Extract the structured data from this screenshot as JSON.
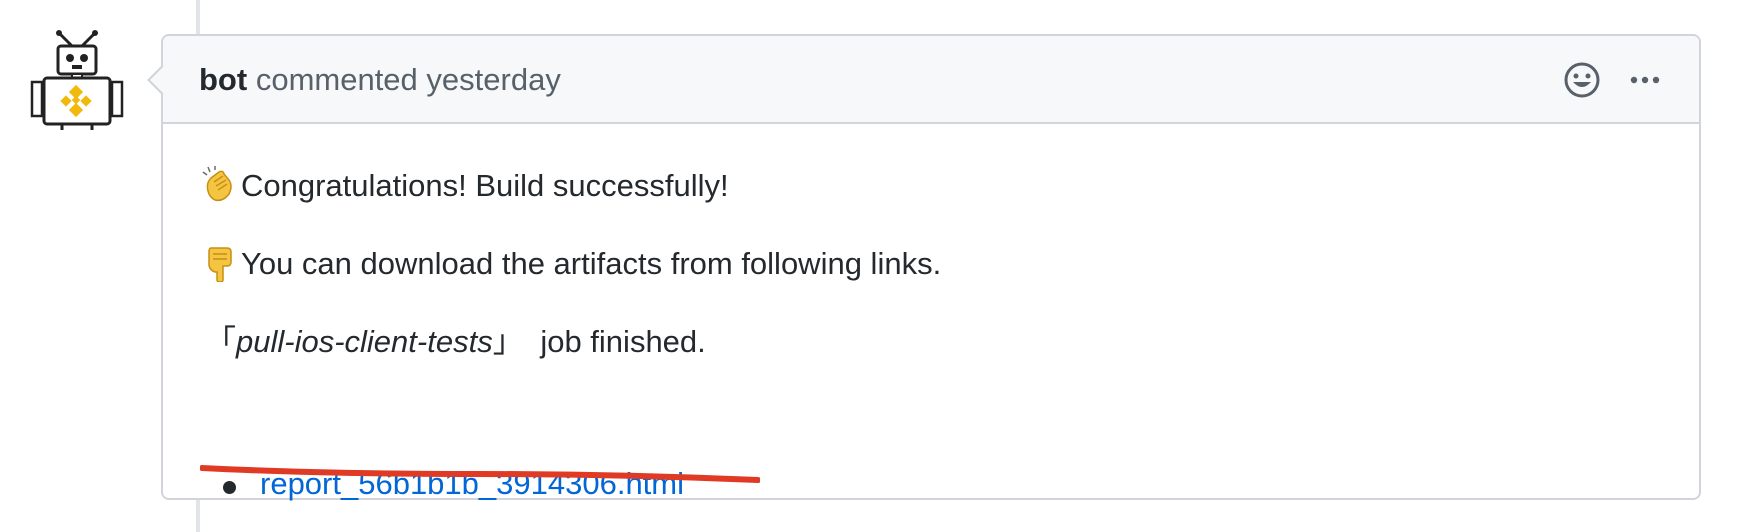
{
  "comment": {
    "author": "bot",
    "action_text": "commented",
    "time_text": "yesterday",
    "avatar_icon": "robot-avatar-icon",
    "header_icons": [
      "smiley-reaction-icon",
      "kebab-more-icon"
    ],
    "body": {
      "line1_emoji": "clapping-hands-icon",
      "line1_text": "Congratulations! Build successfully!",
      "line2_emoji": "pointing-down-icon",
      "line2_text": "You can download the artifacts from following links.",
      "job_open_bracket": "「",
      "job_name": "pull-ios-client-tests",
      "job_close_bracket": "」",
      "job_suffix": "job finished.",
      "artifact_link": "report_56b1b1b_3914306.html"
    }
  },
  "colors": {
    "link": "#0366d6",
    "header_bg": "#f6f8fa",
    "border": "#d1d5da",
    "annotation_red": "#e03a25",
    "avatar_gold": "#f0b90b"
  }
}
